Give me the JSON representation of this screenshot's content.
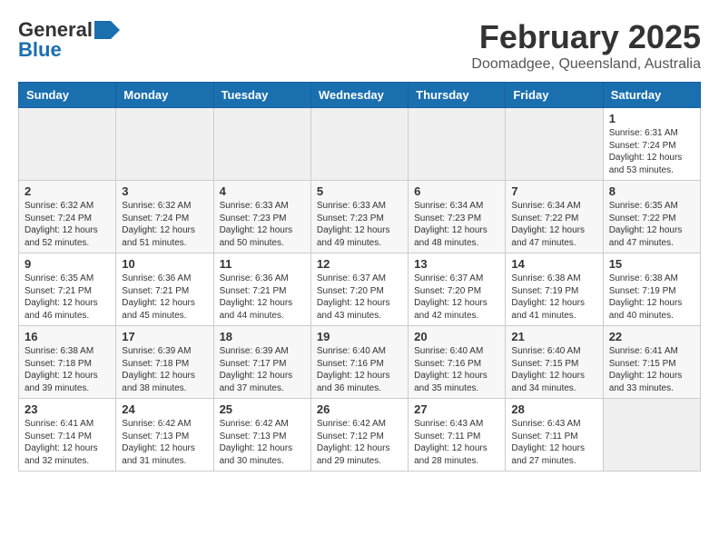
{
  "header": {
    "logo_general": "General",
    "logo_blue": "Blue",
    "month_title": "February 2025",
    "location": "Doomadgee, Queensland, Australia"
  },
  "weekdays": [
    "Sunday",
    "Monday",
    "Tuesday",
    "Wednesday",
    "Thursday",
    "Friday",
    "Saturday"
  ],
  "weeks": [
    [
      {
        "day": "",
        "info": ""
      },
      {
        "day": "",
        "info": ""
      },
      {
        "day": "",
        "info": ""
      },
      {
        "day": "",
        "info": ""
      },
      {
        "day": "",
        "info": ""
      },
      {
        "day": "",
        "info": ""
      },
      {
        "day": "1",
        "info": "Sunrise: 6:31 AM\nSunset: 7:24 PM\nDaylight: 12 hours\nand 53 minutes."
      }
    ],
    [
      {
        "day": "2",
        "info": "Sunrise: 6:32 AM\nSunset: 7:24 PM\nDaylight: 12 hours\nand 52 minutes."
      },
      {
        "day": "3",
        "info": "Sunrise: 6:32 AM\nSunset: 7:24 PM\nDaylight: 12 hours\nand 51 minutes."
      },
      {
        "day": "4",
        "info": "Sunrise: 6:33 AM\nSunset: 7:23 PM\nDaylight: 12 hours\nand 50 minutes."
      },
      {
        "day": "5",
        "info": "Sunrise: 6:33 AM\nSunset: 7:23 PM\nDaylight: 12 hours\nand 49 minutes."
      },
      {
        "day": "6",
        "info": "Sunrise: 6:34 AM\nSunset: 7:23 PM\nDaylight: 12 hours\nand 48 minutes."
      },
      {
        "day": "7",
        "info": "Sunrise: 6:34 AM\nSunset: 7:22 PM\nDaylight: 12 hours\nand 47 minutes."
      },
      {
        "day": "8",
        "info": "Sunrise: 6:35 AM\nSunset: 7:22 PM\nDaylight: 12 hours\nand 47 minutes."
      }
    ],
    [
      {
        "day": "9",
        "info": "Sunrise: 6:35 AM\nSunset: 7:21 PM\nDaylight: 12 hours\nand 46 minutes."
      },
      {
        "day": "10",
        "info": "Sunrise: 6:36 AM\nSunset: 7:21 PM\nDaylight: 12 hours\nand 45 minutes."
      },
      {
        "day": "11",
        "info": "Sunrise: 6:36 AM\nSunset: 7:21 PM\nDaylight: 12 hours\nand 44 minutes."
      },
      {
        "day": "12",
        "info": "Sunrise: 6:37 AM\nSunset: 7:20 PM\nDaylight: 12 hours\nand 43 minutes."
      },
      {
        "day": "13",
        "info": "Sunrise: 6:37 AM\nSunset: 7:20 PM\nDaylight: 12 hours\nand 42 minutes."
      },
      {
        "day": "14",
        "info": "Sunrise: 6:38 AM\nSunset: 7:19 PM\nDaylight: 12 hours\nand 41 minutes."
      },
      {
        "day": "15",
        "info": "Sunrise: 6:38 AM\nSunset: 7:19 PM\nDaylight: 12 hours\nand 40 minutes."
      }
    ],
    [
      {
        "day": "16",
        "info": "Sunrise: 6:38 AM\nSunset: 7:18 PM\nDaylight: 12 hours\nand 39 minutes."
      },
      {
        "day": "17",
        "info": "Sunrise: 6:39 AM\nSunset: 7:18 PM\nDaylight: 12 hours\nand 38 minutes."
      },
      {
        "day": "18",
        "info": "Sunrise: 6:39 AM\nSunset: 7:17 PM\nDaylight: 12 hours\nand 37 minutes."
      },
      {
        "day": "19",
        "info": "Sunrise: 6:40 AM\nSunset: 7:16 PM\nDaylight: 12 hours\nand 36 minutes."
      },
      {
        "day": "20",
        "info": "Sunrise: 6:40 AM\nSunset: 7:16 PM\nDaylight: 12 hours\nand 35 minutes."
      },
      {
        "day": "21",
        "info": "Sunrise: 6:40 AM\nSunset: 7:15 PM\nDaylight: 12 hours\nand 34 minutes."
      },
      {
        "day": "22",
        "info": "Sunrise: 6:41 AM\nSunset: 7:15 PM\nDaylight: 12 hours\nand 33 minutes."
      }
    ],
    [
      {
        "day": "23",
        "info": "Sunrise: 6:41 AM\nSunset: 7:14 PM\nDaylight: 12 hours\nand 32 minutes."
      },
      {
        "day": "24",
        "info": "Sunrise: 6:42 AM\nSunset: 7:13 PM\nDaylight: 12 hours\nand 31 minutes."
      },
      {
        "day": "25",
        "info": "Sunrise: 6:42 AM\nSunset: 7:13 PM\nDaylight: 12 hours\nand 30 minutes."
      },
      {
        "day": "26",
        "info": "Sunrise: 6:42 AM\nSunset: 7:12 PM\nDaylight: 12 hours\nand 29 minutes."
      },
      {
        "day": "27",
        "info": "Sunrise: 6:43 AM\nSunset: 7:11 PM\nDaylight: 12 hours\nand 28 minutes."
      },
      {
        "day": "28",
        "info": "Sunrise: 6:43 AM\nSunset: 7:11 PM\nDaylight: 12 hours\nand 27 minutes."
      },
      {
        "day": "",
        "info": ""
      }
    ]
  ]
}
